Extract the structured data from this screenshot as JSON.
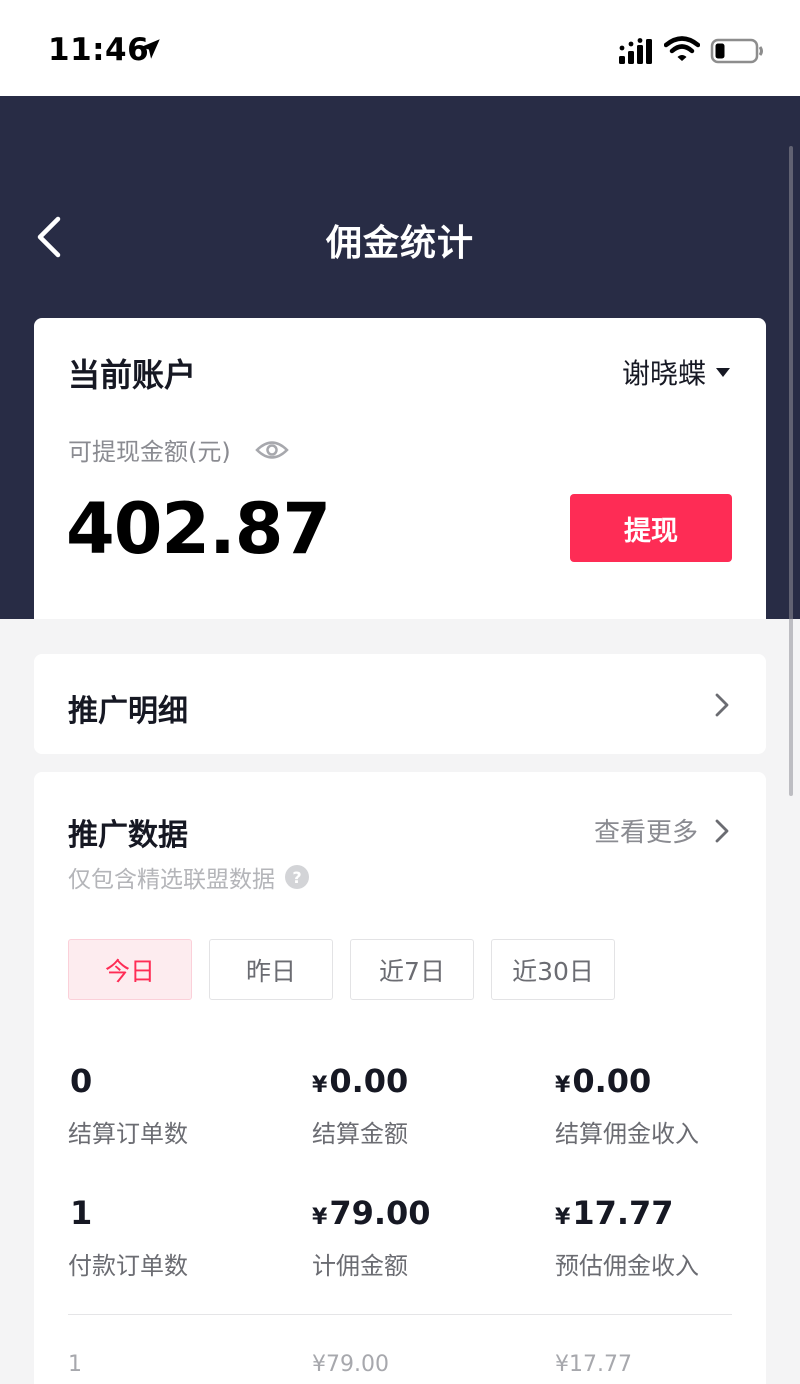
{
  "status_bar": {
    "time": "11:46",
    "icons": [
      "location-arrow-icon",
      "cellular-signal-icon",
      "wifi-icon",
      "battery-icon"
    ]
  },
  "header": {
    "title": "佣金统计",
    "background_color": "#282c45"
  },
  "account": {
    "title": "当前账户",
    "user_name": "谢晓蝶",
    "balance_label": "可提现金额(元)",
    "balance": "402.87",
    "withdraw_label": "提现",
    "accent_color": "#fe2c55"
  },
  "promo_detail": {
    "label": "推广明细"
  },
  "promo_data": {
    "title": "推广数据",
    "view_more": "查看更多",
    "subtitle": "仅包含精选联盟数据",
    "tabs": [
      {
        "label": "今日",
        "active": true
      },
      {
        "label": "昨日",
        "active": false
      },
      {
        "label": "近7日",
        "active": false
      },
      {
        "label": "近30日",
        "active": false
      }
    ],
    "stats": [
      {
        "currency": "",
        "value": "0",
        "label": "结算订单数"
      },
      {
        "currency": "¥",
        "value": "0.00",
        "label": "结算金额"
      },
      {
        "currency": "¥",
        "value": "0.00",
        "label": "结算佣金收入"
      },
      {
        "currency": "",
        "value": "1",
        "label": "付款订单数"
      },
      {
        "currency": "¥",
        "value": "79.00",
        "label": "计佣金额"
      },
      {
        "currency": "¥",
        "value": "17.77",
        "label": "预估佣金收入"
      }
    ],
    "bottom_row": [
      "1",
      "¥79.00",
      "¥17.77"
    ]
  }
}
